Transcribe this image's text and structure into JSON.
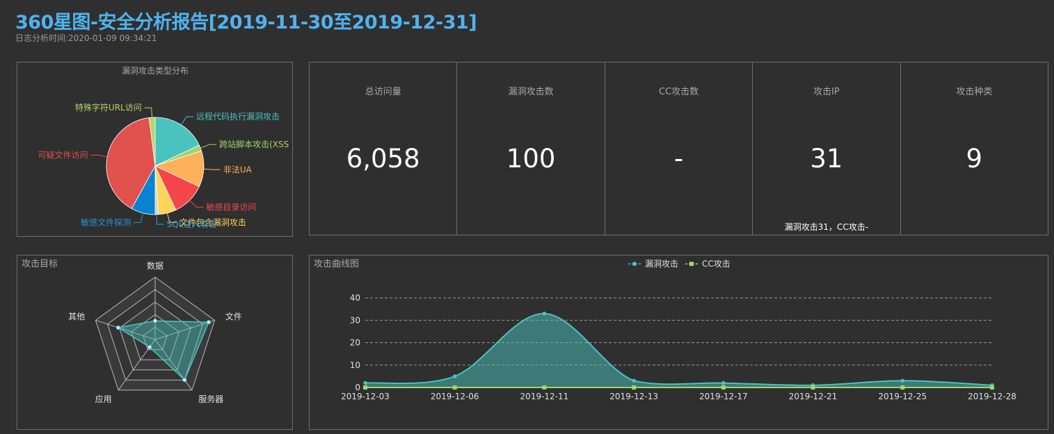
{
  "header": {
    "title": "360星图-安全分析报告[2019-11-30至2019-12-31]",
    "subtitle": "日志分析时间:2020-01-09 09:34:21"
  },
  "stats": [
    {
      "label": "总访问量",
      "value": "6,058",
      "note": ""
    },
    {
      "label": "漏洞攻击数",
      "value": "100",
      "note": ""
    },
    {
      "label": "CC攻击数",
      "value": "-",
      "note": ""
    },
    {
      "label": "攻击IP",
      "value": "31",
      "note": "漏洞攻击31，CC攻击-"
    },
    {
      "label": "攻击种类",
      "value": "9",
      "note": ""
    }
  ],
  "chart_data": [
    {
      "type": "pie",
      "title": "漏洞攻击类型分布",
      "slices": [
        {
          "label": "远程代码执行漏洞攻击",
          "value": 18,
          "color": "#4ac3bf",
          "label_color": "#4ac3bf"
        },
        {
          "label": "跨站脚本攻击(XSS",
          "value": 2,
          "color": "#a4d36c",
          "label_color": "#a4d36c"
        },
        {
          "label": "非法UA",
          "value": 12,
          "color": "#ffb05a",
          "label_color": "#ffb05a"
        },
        {
          "label": "敏感目录访问",
          "value": 11,
          "color": "#f2464a",
          "label_color": "#f2464a"
        },
        {
          "label": "文件包含漏洞攻击",
          "value": 6,
          "color": "#fed45a",
          "label_color": "#fed45a"
        },
        {
          "label": "SQL注入攻击",
          "value": 1,
          "color": "#c8d0d4",
          "label_color": "#3aa0e0"
        },
        {
          "label": "敏感文件探测",
          "value": 8,
          "color": "#0a82d2",
          "label_color": "#2a90d6"
        },
        {
          "label": "可疑文件访问",
          "value": 40,
          "color": "#e1514e",
          "label_color": "#e1514e"
        },
        {
          "label": "特殊字符URL访问",
          "value": 2,
          "color": "#b5d56a",
          "label_color": "#b5d56a"
        }
      ]
    },
    {
      "type": "radar",
      "title": "攻击目标",
      "axes": [
        "数据",
        "文件",
        "服务器",
        "应用",
        "其他"
      ],
      "max": 100,
      "values": [
        30,
        90,
        80,
        15,
        62
      ]
    },
    {
      "type": "line",
      "title": "攻击曲线图",
      "categories": [
        "2019-12-03",
        "2019-12-06",
        "2019-12-11",
        "2019-12-13",
        "2019-12-17",
        "2019-12-21",
        "2019-12-25",
        "2019-12-28"
      ],
      "y_ticks": [
        0,
        10,
        20,
        30,
        40
      ],
      "ylim": [
        0,
        40
      ],
      "series": [
        {
          "name": "漏洞攻击",
          "color": "#4ac3bf",
          "values": [
            2,
            5,
            33,
            3,
            2,
            1,
            3,
            1
          ]
        },
        {
          "name": "CC攻击",
          "color": "#a4d36c",
          "values": [
            0,
            0,
            0,
            0,
            0,
            0,
            0,
            0
          ]
        }
      ]
    }
  ],
  "colors": {
    "accent": "#4fb3ee",
    "panel_border": "#6e6e6e",
    "background": "#2f2f2f"
  }
}
